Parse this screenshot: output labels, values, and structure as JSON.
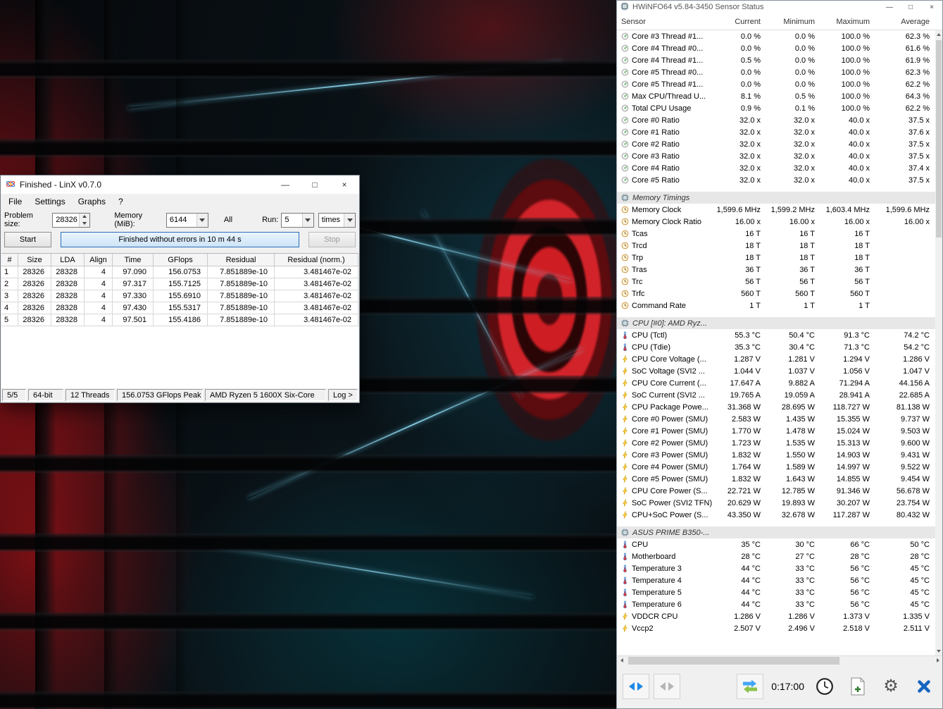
{
  "window_controls": {
    "minimize": "—",
    "maximize": "□",
    "close": "×"
  },
  "icons": {
    "gear": "⚙"
  },
  "colors": {
    "accent_blue": "#2a6dbd",
    "progress_fill": "#cde4f7",
    "bolt_yellow": "#ffd54f",
    "red_wallpaper": "#cf1d24"
  },
  "linx": {
    "title": "Finished - LinX v0.7.0",
    "menu": [
      "File",
      "Settings",
      "Graphs",
      "?"
    ],
    "controls": {
      "problem_size_label": "Problem size:",
      "problem_size_value": "28326",
      "memory_label": "Memory (MiB):",
      "memory_value": "6144",
      "all_label": "All",
      "run_label": "Run:",
      "run_value": "5",
      "times_value": "times"
    },
    "start_button": "Start",
    "progress_text": "Finished without errors in 10 m 44 s",
    "stop_button": "Stop",
    "table": {
      "headers": [
        "#",
        "Size",
        "LDA",
        "Align",
        "Time",
        "GFlops",
        "Residual",
        "Residual (norm.)"
      ],
      "rows": [
        [
          "1",
          "28326",
          "28328",
          "4",
          "97.090",
          "156.0753",
          "7.851889e-10",
          "3.481467e-02"
        ],
        [
          "2",
          "28326",
          "28328",
          "4",
          "97.317",
          "155.7125",
          "7.851889e-10",
          "3.481467e-02"
        ],
        [
          "3",
          "28326",
          "28328",
          "4",
          "97.330",
          "155.6910",
          "7.851889e-10",
          "3.481467e-02"
        ],
        [
          "4",
          "28326",
          "28328",
          "4",
          "97.430",
          "155.5317",
          "7.851889e-10",
          "3.481467e-02"
        ],
        [
          "5",
          "28326",
          "28328",
          "4",
          "97.501",
          "155.4186",
          "7.851889e-10",
          "3.481467e-02"
        ]
      ]
    },
    "status_bar": [
      "5/5",
      "64-bit",
      "12 Threads",
      "156.0753 GFlops Peak",
      "AMD Ryzen 5 1600X Six-Core",
      "Log >"
    ]
  },
  "hwinfo": {
    "title": "HWiNFO64 v5.84-3450 Sensor Status",
    "columns": [
      "Sensor",
      "Current",
      "Minimum",
      "Maximum",
      "Average"
    ],
    "toolbar": {
      "timer": "0:17:00"
    },
    "rows": [
      {
        "type": "sensor",
        "icon": "gauge",
        "label": "Core #3 Thread #1...",
        "values": [
          "0.0 %",
          "0.0 %",
          "100.0 %",
          "62.3 %"
        ]
      },
      {
        "type": "sensor",
        "icon": "gauge",
        "label": "Core #4 Thread #0...",
        "values": [
          "0.0 %",
          "0.0 %",
          "100.0 %",
          "61.6 %"
        ]
      },
      {
        "type": "sensor",
        "icon": "gauge",
        "label": "Core #4 Thread #1...",
        "values": [
          "0.5 %",
          "0.0 %",
          "100.0 %",
          "61.9 %"
        ]
      },
      {
        "type": "sensor",
        "icon": "gauge",
        "label": "Core #5 Thread #0...",
        "values": [
          "0.0 %",
          "0.0 %",
          "100.0 %",
          "62.3 %"
        ]
      },
      {
        "type": "sensor",
        "icon": "gauge",
        "label": "Core #5 Thread #1...",
        "values": [
          "0.0 %",
          "0.0 %",
          "100.0 %",
          "62.2 %"
        ]
      },
      {
        "type": "sensor",
        "icon": "gauge",
        "label": "Max CPU/Thread U...",
        "values": [
          "8.1 %",
          "0.5 %",
          "100.0 %",
          "64.3 %"
        ]
      },
      {
        "type": "sensor",
        "icon": "gauge",
        "label": "Total CPU Usage",
        "values": [
          "0.9 %",
          "0.1 %",
          "100.0 %",
          "62.2 %"
        ]
      },
      {
        "type": "sensor",
        "icon": "gauge",
        "label": "Core #0 Ratio",
        "values": [
          "32.0 x",
          "32.0 x",
          "40.0 x",
          "37.5 x"
        ]
      },
      {
        "type": "sensor",
        "icon": "gauge",
        "label": "Core #1 Ratio",
        "values": [
          "32.0 x",
          "32.0 x",
          "40.0 x",
          "37.6 x"
        ]
      },
      {
        "type": "sensor",
        "icon": "gauge",
        "label": "Core #2 Ratio",
        "values": [
          "32.0 x",
          "32.0 x",
          "40.0 x",
          "37.5 x"
        ]
      },
      {
        "type": "sensor",
        "icon": "gauge",
        "label": "Core #3 Ratio",
        "values": [
          "32.0 x",
          "32.0 x",
          "40.0 x",
          "37.5 x"
        ]
      },
      {
        "type": "sensor",
        "icon": "gauge",
        "label": "Core #4 Ratio",
        "values": [
          "32.0 x",
          "32.0 x",
          "40.0 x",
          "37.4 x"
        ]
      },
      {
        "type": "sensor",
        "icon": "gauge",
        "label": "Core #5 Ratio",
        "values": [
          "32.0 x",
          "32.0 x",
          "40.0 x",
          "37.5 x"
        ]
      },
      {
        "type": "section",
        "label": "Memory Timings"
      },
      {
        "type": "sensor",
        "icon": "clock",
        "label": "Memory Clock",
        "values": [
          "1,599.6 MHz",
          "1,599.2 MHz",
          "1,603.4 MHz",
          "1,599.6 MHz"
        ]
      },
      {
        "type": "sensor",
        "icon": "clock",
        "label": "Memory Clock Ratio",
        "values": [
          "16.00 x",
          "16.00 x",
          "16.00 x",
          "16.00 x"
        ]
      },
      {
        "type": "sensor",
        "icon": "clock",
        "label": "Tcas",
        "values": [
          "16 T",
          "16 T",
          "16 T",
          ""
        ]
      },
      {
        "type": "sensor",
        "icon": "clock",
        "label": "Trcd",
        "values": [
          "18 T",
          "18 T",
          "18 T",
          ""
        ]
      },
      {
        "type": "sensor",
        "icon": "clock",
        "label": "Trp",
        "values": [
          "18 T",
          "18 T",
          "18 T",
          ""
        ]
      },
      {
        "type": "sensor",
        "icon": "clock",
        "label": "Tras",
        "values": [
          "36 T",
          "36 T",
          "36 T",
          ""
        ]
      },
      {
        "type": "sensor",
        "icon": "clock",
        "label": "Trc",
        "values": [
          "56 T",
          "56 T",
          "56 T",
          ""
        ]
      },
      {
        "type": "sensor",
        "icon": "clock",
        "label": "Trfc",
        "values": [
          "560 T",
          "560 T",
          "560 T",
          ""
        ]
      },
      {
        "type": "sensor",
        "icon": "clock",
        "label": "Command Rate",
        "values": [
          "1 T",
          "1 T",
          "1 T",
          ""
        ]
      },
      {
        "type": "section",
        "label": "CPU [#0]: AMD Ryz..."
      },
      {
        "type": "sensor",
        "icon": "thermo",
        "label": "CPU (Tctl)",
        "values": [
          "55.3 °C",
          "50.4 °C",
          "91.3 °C",
          "74.2 °C"
        ]
      },
      {
        "type": "sensor",
        "icon": "thermo",
        "label": "CPU (Tdie)",
        "values": [
          "35.3 °C",
          "30.4 °C",
          "71.3 °C",
          "54.2 °C"
        ]
      },
      {
        "type": "sensor",
        "icon": "bolt",
        "label": "CPU Core Voltage (...",
        "values": [
          "1.287 V",
          "1.281 V",
          "1.294 V",
          "1.286 V"
        ]
      },
      {
        "type": "sensor",
        "icon": "bolt",
        "label": "SoC Voltage (SVI2 ...",
        "values": [
          "1.044 V",
          "1.037 V",
          "1.056 V",
          "1.047 V"
        ]
      },
      {
        "type": "sensor",
        "icon": "bolt",
        "label": "CPU Core Current (...",
        "values": [
          "17.647 A",
          "9.882 A",
          "71.294 A",
          "44.156 A"
        ]
      },
      {
        "type": "sensor",
        "icon": "bolt",
        "label": "SoC Current (SVI2 ...",
        "values": [
          "19.765 A",
          "19.059 A",
          "28.941 A",
          "22.685 A"
        ]
      },
      {
        "type": "sensor",
        "icon": "bolt",
        "label": "CPU Package Powe...",
        "values": [
          "31.368 W",
          "28.695 W",
          "118.727 W",
          "81.138 W"
        ]
      },
      {
        "type": "sensor",
        "icon": "bolt",
        "label": "Core #0 Power (SMU)",
        "values": [
          "2.583 W",
          "1.435 W",
          "15.355 W",
          "9.737 W"
        ]
      },
      {
        "type": "sensor",
        "icon": "bolt",
        "label": "Core #1 Power (SMU)",
        "values": [
          "1.770 W",
          "1.478 W",
          "15.024 W",
          "9.503 W"
        ]
      },
      {
        "type": "sensor",
        "icon": "bolt",
        "label": "Core #2 Power (SMU)",
        "values": [
          "1.723 W",
          "1.535 W",
          "15.313 W",
          "9.600 W"
        ]
      },
      {
        "type": "sensor",
        "icon": "bolt",
        "label": "Core #3 Power (SMU)",
        "values": [
          "1.832 W",
          "1.550 W",
          "14.903 W",
          "9.431 W"
        ]
      },
      {
        "type": "sensor",
        "icon": "bolt",
        "label": "Core #4 Power (SMU)",
        "values": [
          "1.764 W",
          "1.589 W",
          "14.997 W",
          "9.522 W"
        ]
      },
      {
        "type": "sensor",
        "icon": "bolt",
        "label": "Core #5 Power (SMU)",
        "values": [
          "1.832 W",
          "1.643 W",
          "14.855 W",
          "9.454 W"
        ]
      },
      {
        "type": "sensor",
        "icon": "bolt",
        "label": "CPU Core Power (S...",
        "values": [
          "22.721 W",
          "12.785 W",
          "91.346 W",
          "56.678 W"
        ]
      },
      {
        "type": "sensor",
        "icon": "bolt",
        "label": "SoC Power (SVI2 TFN)",
        "values": [
          "20.629 W",
          "19.893 W",
          "30.207 W",
          "23.754 W"
        ]
      },
      {
        "type": "sensor",
        "icon": "bolt",
        "label": "CPU+SoC Power (S...",
        "values": [
          "43.350 W",
          "32.678 W",
          "117.287 W",
          "80.432 W"
        ]
      },
      {
        "type": "section",
        "label": "ASUS PRIME B350-..."
      },
      {
        "type": "sensor",
        "icon": "thermo",
        "label": "CPU",
        "values": [
          "35 °C",
          "30 °C",
          "66 °C",
          "50 °C"
        ]
      },
      {
        "type": "sensor",
        "icon": "thermo",
        "label": "Motherboard",
        "values": [
          "28 °C",
          "27 °C",
          "28 °C",
          "28 °C"
        ]
      },
      {
        "type": "sensor",
        "icon": "thermo",
        "label": "Temperature 3",
        "values": [
          "44 °C",
          "33 °C",
          "56 °C",
          "45 °C"
        ]
      },
      {
        "type": "sensor",
        "icon": "thermo",
        "label": "Temperature 4",
        "values": [
          "44 °C",
          "33 °C",
          "56 °C",
          "45 °C"
        ]
      },
      {
        "type": "sensor",
        "icon": "thermo",
        "label": "Temperature 5",
        "values": [
          "44 °C",
          "33 °C",
          "56 °C",
          "45 °C"
        ]
      },
      {
        "type": "sensor",
        "icon": "thermo",
        "label": "Temperature 6",
        "values": [
          "44 °C",
          "33 °C",
          "56 °C",
          "45 °C"
        ]
      },
      {
        "type": "sensor",
        "icon": "bolt",
        "label": "VDDCR CPU",
        "values": [
          "1.286 V",
          "1.286 V",
          "1.373 V",
          "1.335 V"
        ]
      },
      {
        "type": "sensor",
        "icon": "bolt",
        "label": "Vccp2",
        "values": [
          "2.507 V",
          "2.496 V",
          "2.518 V",
          "2.511 V"
        ]
      }
    ]
  }
}
